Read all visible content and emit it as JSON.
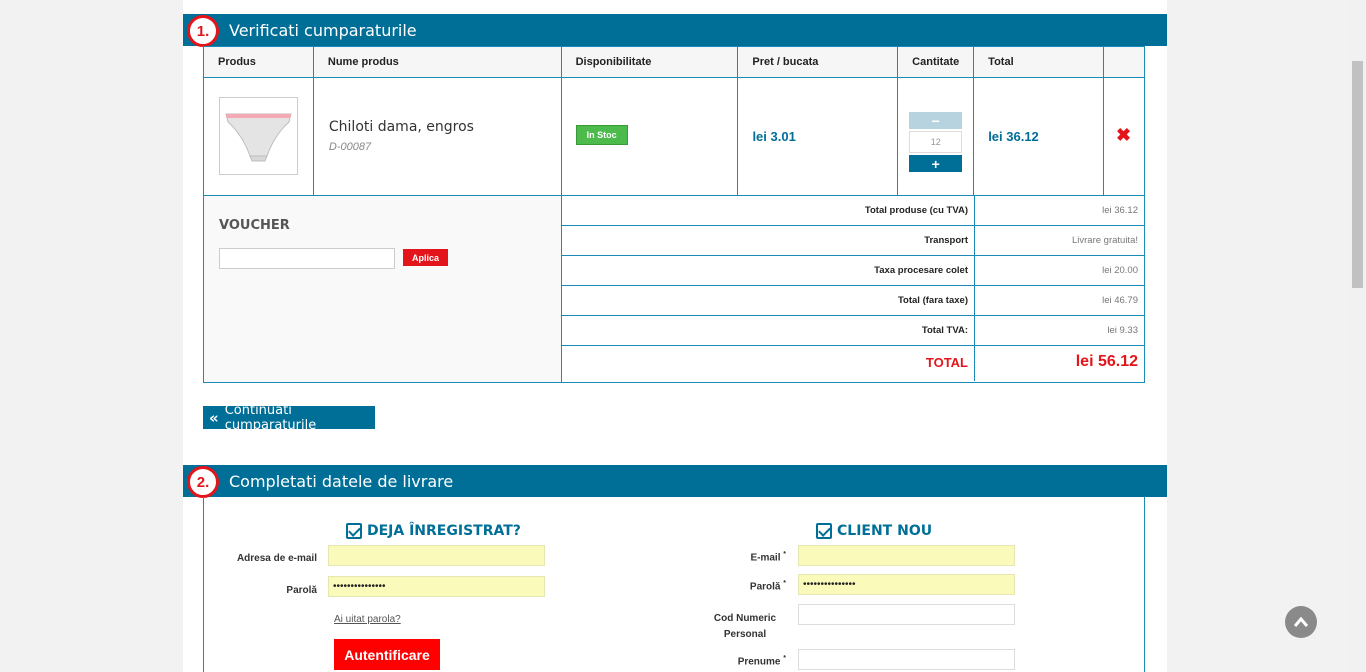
{
  "section1": {
    "number": "1.",
    "title": "Verificati cumparaturile"
  },
  "cart": {
    "headers": [
      "Produs",
      "Nume produs",
      "Disponibilitate",
      "Pret / bucata",
      "Cantitate",
      "Total",
      ""
    ],
    "item": {
      "image_icon": "product-photo",
      "name": "Chiloti dama, engros",
      "code": "D-00087",
      "availability": "In Stoc",
      "price": "lei 3.01",
      "quantity": "12",
      "minus_label": "−",
      "plus_label": "+",
      "total": "lei 36.12",
      "remove_icon": "✖"
    }
  },
  "voucher": {
    "title": "VOUCHER",
    "placeholder": "",
    "apply_label": "Aplica"
  },
  "totals": [
    {
      "label": "Total produse (cu TVA)",
      "value": "lei 36.12"
    },
    {
      "label": "Transport",
      "value": "Livrare gratuita!"
    },
    {
      "label": "Taxa procesare colet",
      "value": "lei 20.00"
    },
    {
      "label": "Total (fara taxe)",
      "value": "lei 46.79"
    },
    {
      "label": "Total TVA:",
      "value": "lei 9.33"
    },
    {
      "label": "TOTAL",
      "value": "lei 56.12"
    }
  ],
  "continue_label": "Continuati cumparaturile",
  "section2": {
    "number": "2.",
    "title": "Completati datele de livrare"
  },
  "login": {
    "heading": "DEJA ÎNREGISTRAT?",
    "email_label": "Adresa de e-mail",
    "email_value": "",
    "password_label": "Parolă",
    "password_value": "•••••••••••••••",
    "forgot_label": "Ai uitat parola?",
    "auth_label": "Autentificare"
  },
  "register": {
    "heading": "CLIENT NOU",
    "email_label": "E-mail",
    "email_value": "",
    "password_label": "Parolă",
    "password_value": "•••••••••••••••",
    "cnp_label": "Cod Numeric Personal",
    "cnp_value": "",
    "firstname_label": "Prenume",
    "firstname_value": "",
    "required_mark": "*"
  },
  "colors": {
    "primary": "#006f98",
    "accent": "#e3151a",
    "stock": "#4cbb4c",
    "autofill": "#fafbbb"
  }
}
